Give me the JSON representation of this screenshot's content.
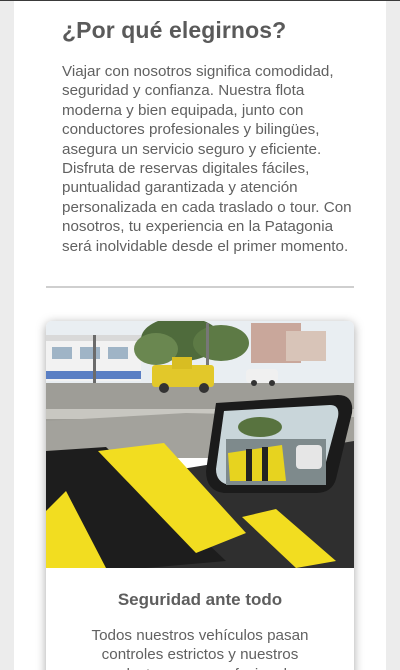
{
  "section": {
    "title": "¿Por qué elegirnos?",
    "description": "Viajar con nosotros significa comodidad, seguridad y confianza. Nuestra flota moderna y bien equipada, junto con conductores profesionales y bilingües, asegura un servicio seguro y eficiente. Disfruta de reservas digitales fáciles, puntualidad garantizada y atención personalizada en cada traslado o tour. Con nosotros, tu experiencia en la Patagonia será inolvidable desde el primer momento."
  },
  "card": {
    "image_icon": "car-side-mirror-photo",
    "title": "Seguridad ante todo",
    "text": "Todos nuestros vehículos pasan controles estrictos y nuestros conductores son profesionales"
  }
}
